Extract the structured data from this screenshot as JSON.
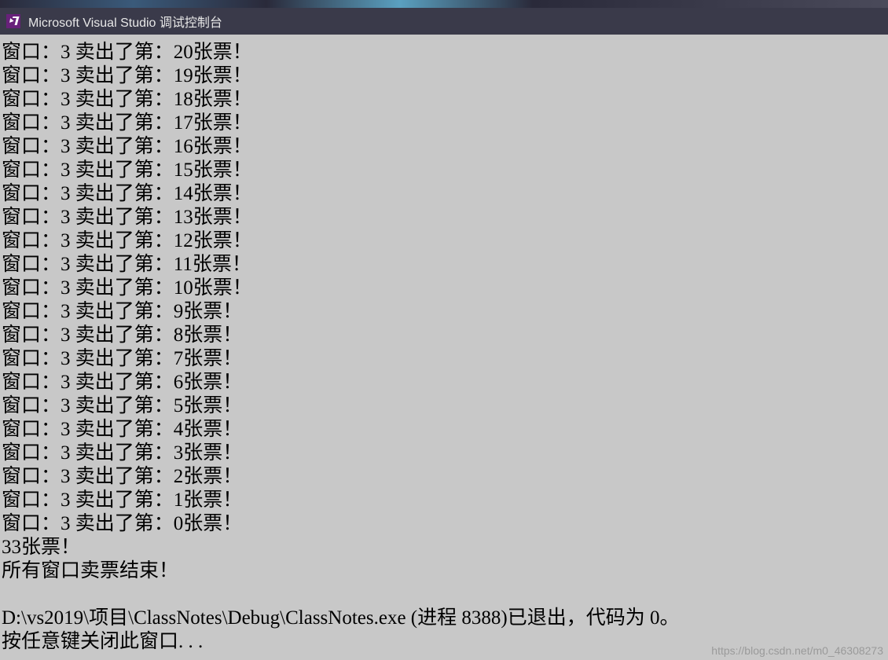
{
  "titleBar": {
    "title": "Microsoft Visual Studio 调试控制台"
  },
  "console": {
    "ticketLines": [
      {
        "window": "3",
        "ticketNum": "20"
      },
      {
        "window": "3",
        "ticketNum": "19"
      },
      {
        "window": "3",
        "ticketNum": "18"
      },
      {
        "window": "3",
        "ticketNum": "17"
      },
      {
        "window": "3",
        "ticketNum": "16"
      },
      {
        "window": "3",
        "ticketNum": "15"
      },
      {
        "window": "3",
        "ticketNum": "14"
      },
      {
        "window": "3",
        "ticketNum": "13"
      },
      {
        "window": "3",
        "ticketNum": "12"
      },
      {
        "window": "3",
        "ticketNum": "11"
      },
      {
        "window": "3",
        "ticketNum": "10"
      },
      {
        "window": "3",
        "ticketNum": "9"
      },
      {
        "window": "3",
        "ticketNum": "8"
      },
      {
        "window": "3",
        "ticketNum": "7"
      },
      {
        "window": "3",
        "ticketNum": "6"
      },
      {
        "window": "3",
        "ticketNum": "5"
      },
      {
        "window": "3",
        "ticketNum": "4"
      },
      {
        "window": "3",
        "ticketNum": "3"
      },
      {
        "window": "3",
        "ticketNum": "2"
      },
      {
        "window": "3",
        "ticketNum": "1"
      },
      {
        "window": "3",
        "ticketNum": "0"
      }
    ],
    "linePrefix": "窗口：",
    "lineMid": " 卖出了第：",
    "lineSuffix": "张票！",
    "extraLine1": "33张票！",
    "finishLine": "所有窗口卖票结束！",
    "exitLine": "D:\\vs2019\\项目\\ClassNotes\\Debug\\ClassNotes.exe (进程 8388)已退出，代码为 0。",
    "promptLine": "按任意键关闭此窗口. . ."
  },
  "watermark": "https://blog.csdn.net/m0_46308273"
}
